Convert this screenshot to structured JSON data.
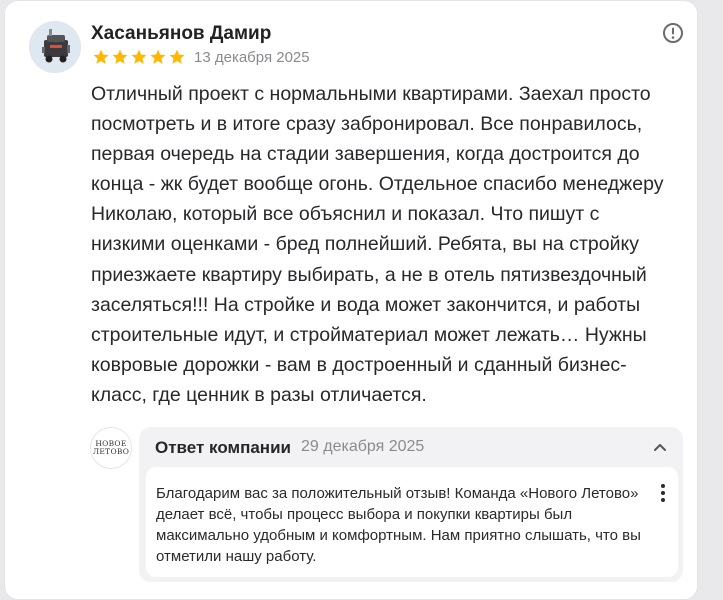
{
  "review": {
    "author": "Хасаньянов Дамир",
    "rating": 5,
    "date": "13 декабря 2025",
    "text": "Отличный проект с нормальными квартирами. Заехал просто посмотреть и в итоге сразу забронировал. Все понравилось, первая очередь на стадии завершения, когда достроится до конца - жк будет вообще огонь. Отдельное спасибо менеджеру Николаю, который все объяснил и показал. Что пишут с низкими оценками - бред полнейший. Ребята, вы на стройку приезжаете квартиру выбирать, а не в отель пятизвездочный заселяться!!! На стройке и вода может закончится, и работы строительные идут, и стройматериал может лежать… Нужны ковровые дорожки - вам в достроенный и сданный бизнес-класс, где ценник в разы отличается."
  },
  "reply": {
    "title": "Ответ компании",
    "date": "29 декабря 2025",
    "logo_line1": "НОВОЕ",
    "logo_line2": "ЛЕТОВО",
    "text": "Благодарим вас за положительный отзыв! Команда «Нового Летово» делает всё, чтобы процесс выбора и покупки квартиры был максимально удобным и комфортным. Нам приятно слышать, что вы отметили нашу работу."
  },
  "icons": {
    "info": "info-circle-icon",
    "star": "star-icon",
    "collapse": "chevron-up-icon",
    "more": "more-vertical-icon"
  },
  "colors": {
    "star": "#ffb800",
    "muted_text": "#8a8a90",
    "reply_background": "#f2f2f4"
  }
}
